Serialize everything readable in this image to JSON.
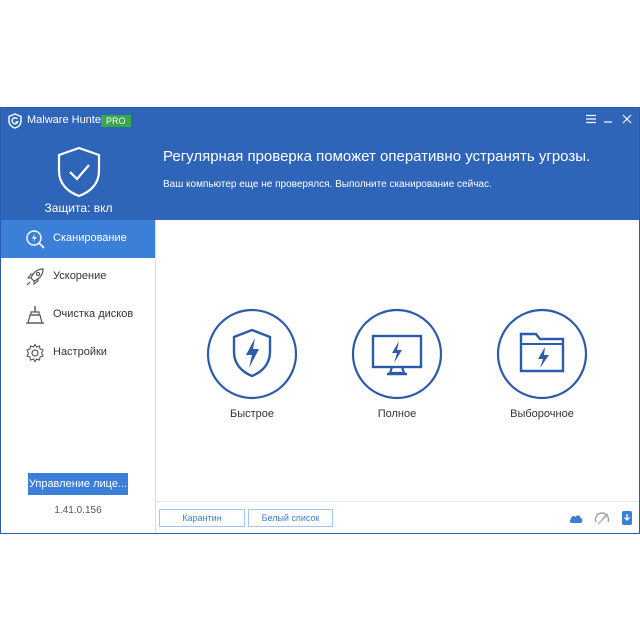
{
  "app": {
    "name": "Malware Hunter",
    "badge": "PRO"
  },
  "titlebar": {
    "menu_icon": "hamburger-icon",
    "minimize_icon": "minimize-icon",
    "close_icon": "close-icon"
  },
  "status": {
    "protection": "Защита: вкл",
    "headline": "Регулярная проверка поможет оперативно устранять угрозы.",
    "subline": "Ваш компьютер еще не проверялся. Выполните сканирование сейчас."
  },
  "sidebar": {
    "items": [
      {
        "label": "Сканирование",
        "icon": "scan-icon",
        "active": true
      },
      {
        "label": "Ускорение",
        "icon": "rocket-icon",
        "active": false
      },
      {
        "label": "Очистка дисков",
        "icon": "broom-icon",
        "active": false
      },
      {
        "label": "Настройки",
        "icon": "gear-icon",
        "active": false
      }
    ],
    "license_button": "Управление лице...",
    "version": "1.41.0.156"
  },
  "scan_options": [
    {
      "label": "Быстрое",
      "icon": "shield-bolt-icon"
    },
    {
      "label": "Полное",
      "icon": "monitor-bolt-icon"
    },
    {
      "label": "Выборочное",
      "icon": "folder-bolt-icon"
    }
  ],
  "footer": {
    "quarantine": "Карантин",
    "whitelist": "Белый список",
    "icons": [
      "cloud-icon",
      "speedometer-icon",
      "update-icon"
    ]
  },
  "colors": {
    "header": "#2f65b9",
    "accent": "#3b7fd8",
    "icon_stroke": "#2b5ba9",
    "pro_badge": "#38a84a"
  }
}
